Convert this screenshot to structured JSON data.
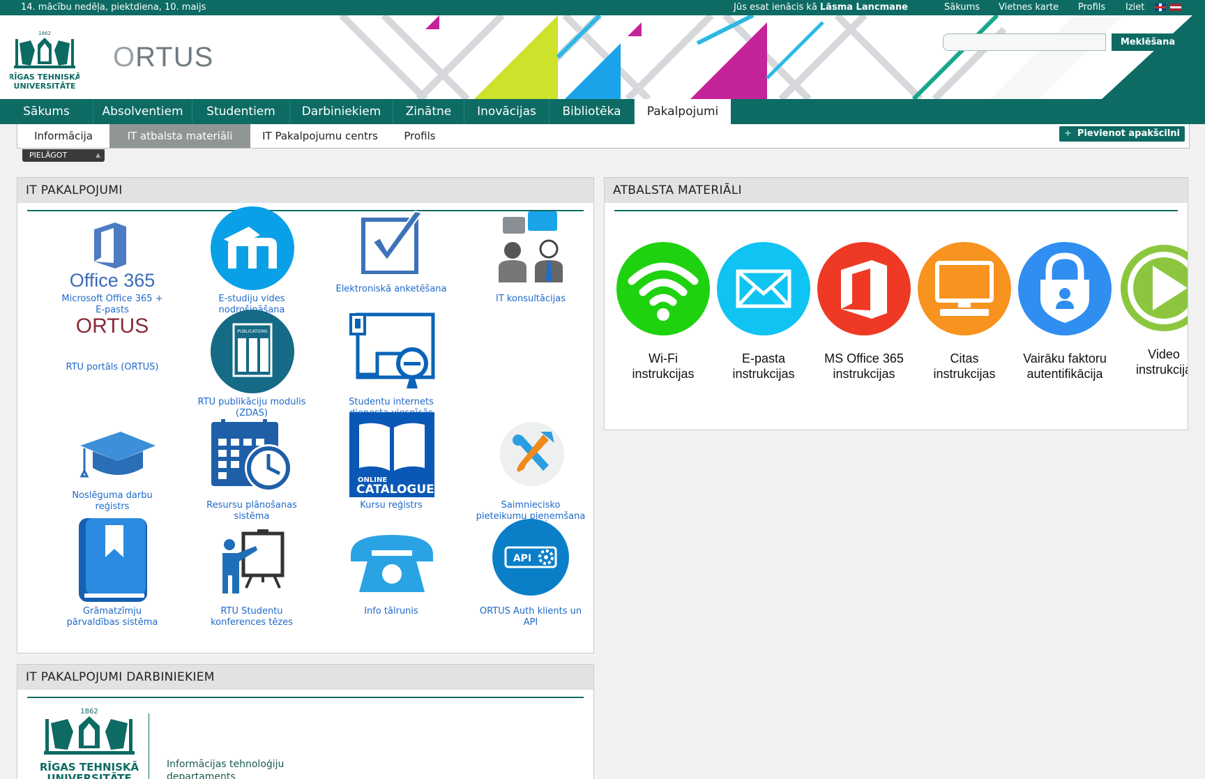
{
  "topbar": {
    "date": "14. mācību nedēļa, piektdiena, 10. maijs",
    "login_prefix": "Jūs esat ienācis kā",
    "user": "Lāsma Lancmane",
    "links": [
      "Sākums",
      "Vietnes karte",
      "Profils",
      "Iziet"
    ]
  },
  "header": {
    "rtu_logo_year": "1862",
    "rtu_logo_line1": "RĪGAS TEHNISKĀ",
    "rtu_logo_line2": "UNIVERSITĀTE",
    "ortus_logo": "RTUS",
    "ortus_logo_o": "O",
    "search_button": "Meklēšana",
    "search_value": ""
  },
  "mainnav": [
    "Sākums",
    "Absolventiem",
    "Studentiem",
    "Darbiniekiem",
    "Zinātne",
    "Inovācijas",
    "Bibliotēka",
    "Pakalpojumi"
  ],
  "subnav": [
    "Informācija",
    "IT atbalsta materiāli",
    "IT Pakalpojumu centrs",
    "Profils"
  ],
  "add_portlet": "Pievienot apakšcilni",
  "pielagot": "PIELĀGOT",
  "it_services": {
    "title": "IT PAKALPOJUMI",
    "tiles": [
      {
        "label": "Microsoft Office 365 +\nE-pasts",
        "icon": "office365-icon",
        "icon_text": "Office 365"
      },
      {
        "label": "E-studiju vides\nnodrošināšana",
        "icon": "moodle-icon"
      },
      {
        "label": "Elektroniskā anketēšana",
        "icon": "checkbox-icon"
      },
      {
        "label": "IT konsultācijas",
        "icon": "consultation-icon"
      },
      {
        "label": "RTU portāls (ORTUS)",
        "icon": "ortus-logo-icon",
        "icon_text": "ORTUS"
      },
      {
        "label": "RTU publikāciju modulis\n(ZDAS)",
        "icon": "publications-icon",
        "icon_text": "PUBLICATIONS"
      },
      {
        "label": "Studentu internets\ndienesta viesnīcās",
        "icon": "network-icon"
      },
      {
        "label": "Noslēguma darbu\nreģistrs",
        "icon": "graduation-cap-icon"
      },
      {
        "label": "Resursu plānošanas\nsistēma",
        "icon": "calendar-clock-icon"
      },
      {
        "label": "Kursu reģistrs",
        "icon": "catalogue-icon",
        "icon_text1": "ONLINE",
        "icon_text2": "CATALOGUE"
      },
      {
        "label": "Saimniecisko\npieteikumu pieņemšana",
        "icon": "tools-icon"
      },
      {
        "label": "Grāmatzīmju\npārvaldības sistēma",
        "icon": "bookmark-icon"
      },
      {
        "label": "RTU Studentu\nkonferences tēzes",
        "icon": "presentation-icon"
      },
      {
        "label": "Info tālrunis",
        "icon": "phone-icon"
      },
      {
        "label": "ORTUS Auth klients un\nAPI",
        "icon": "api-gear-icon",
        "icon_text": "API"
      }
    ]
  },
  "materials": {
    "title": "ATBALSTA MATERIĀLI",
    "items": [
      {
        "label": "Wi-Fi\ninstrukcijas",
        "icon": "wifi-icon",
        "color": "#1ed20f"
      },
      {
        "label": "E-pasta\ninstrukcijas",
        "icon": "mail-icon",
        "color": "#0fc3f2"
      },
      {
        "label": "MS Office 365\ninstrukcijas",
        "icon": "office-icon",
        "color": "#ee3a24"
      },
      {
        "label": "Citas\ninstrukcijas",
        "icon": "computer-icon",
        "color": "#f7931e"
      },
      {
        "label": "Vairāku faktoru\nautentifikācija",
        "icon": "lock-icon",
        "color": "#2f8ef0"
      },
      {
        "label": "Video\ninstrukcija",
        "icon": "play-icon",
        "color": "#8cc63f"
      }
    ]
  },
  "staff": {
    "title": "IT PAKALPOJUMI DARBINIEKIEM",
    "dept_line1": "Informācijas tehnoloģiju",
    "dept_line2": "departaments"
  },
  "colors": {
    "brand": "#0d6b63",
    "link": "#1e69c9"
  }
}
